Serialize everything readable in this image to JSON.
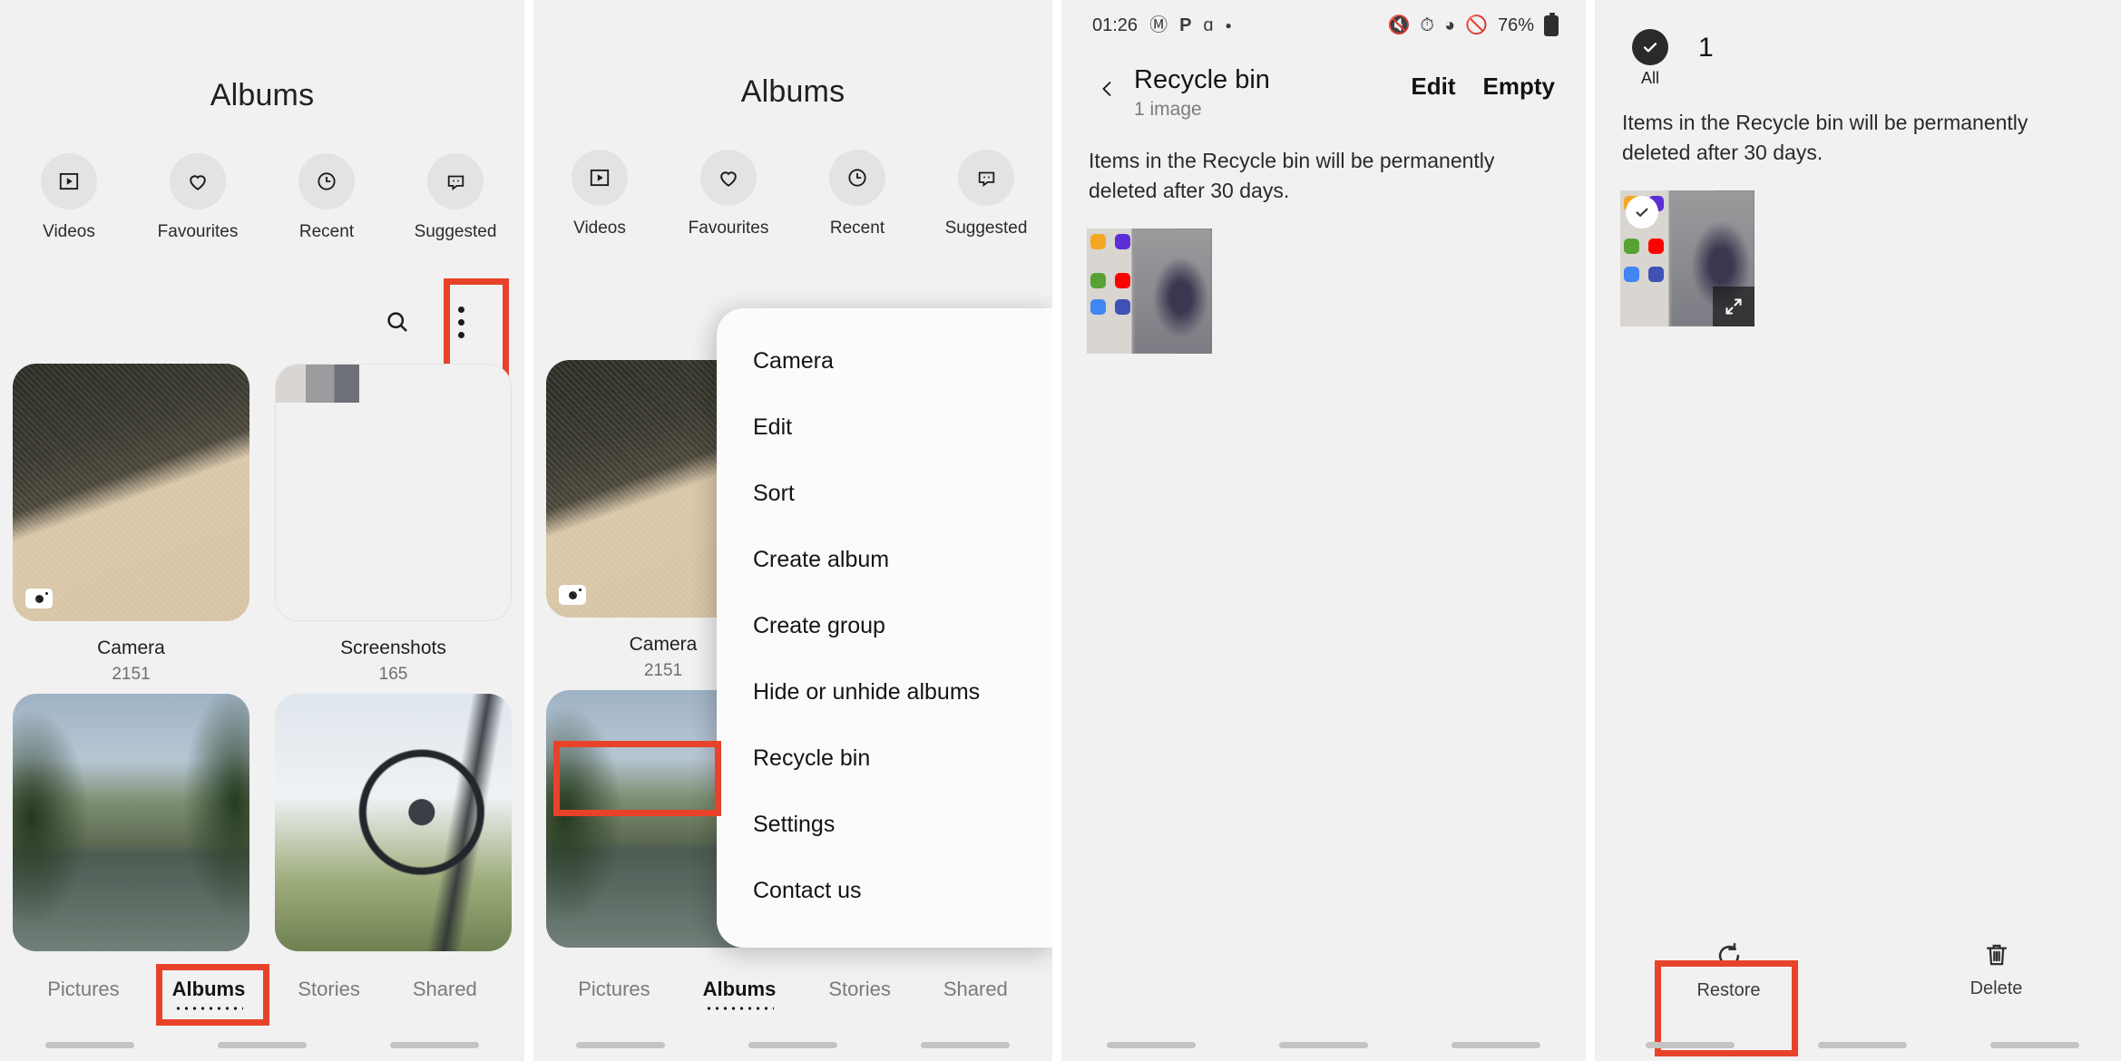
{
  "panel1": {
    "title": "Albums",
    "quick_items": [
      {
        "label": "Videos",
        "icon": "video-icon"
      },
      {
        "label": "Favourites",
        "icon": "heart-icon"
      },
      {
        "label": "Recent",
        "icon": "clock-icon"
      },
      {
        "label": "Suggested",
        "icon": "suggested-icon"
      }
    ],
    "search_icon": "search-icon",
    "more_icon": "more-vertical-icon",
    "albums": [
      {
        "name": "Camera",
        "count": "2151"
      },
      {
        "name": "Screenshots",
        "count": "165"
      }
    ],
    "tabs": [
      {
        "label": "Pictures",
        "active": false
      },
      {
        "label": "Albums",
        "active": true
      },
      {
        "label": "Stories",
        "active": false
      },
      {
        "label": "Shared",
        "active": false
      }
    ]
  },
  "panel2": {
    "title": "Albums",
    "quick_items": [
      {
        "label": "Videos",
        "icon": "video-icon"
      },
      {
        "label": "Favourites",
        "icon": "heart-icon"
      },
      {
        "label": "Recent",
        "icon": "clock-icon"
      },
      {
        "label": "Suggested",
        "icon": "suggested-icon"
      }
    ],
    "albums": [
      {
        "name": "Camera",
        "count": "2151"
      }
    ],
    "menu_items": [
      "Camera",
      "Edit",
      "Sort",
      "Create album",
      "Create group",
      "Hide or unhide albums",
      "Recycle bin",
      "Settings",
      "Contact us"
    ],
    "highlighted_menu_item": "Recycle bin",
    "tabs": [
      {
        "label": "Pictures",
        "active": false
      },
      {
        "label": "Albums",
        "active": true
      },
      {
        "label": "Stories",
        "active": false
      },
      {
        "label": "Shared",
        "active": false
      }
    ]
  },
  "panel3": {
    "status": {
      "time": "01:26",
      "left_icons": [
        "gmail-icon",
        "paypal-icon",
        "wattpad-icon",
        "dot-icon"
      ],
      "right_icons": [
        "mute-vibrate-icon",
        "alarm-icon",
        "wifi-icon",
        "do-not-disturb-icon"
      ],
      "battery": "76%"
    },
    "back_icon": "back-chevron-icon",
    "title": "Recycle bin",
    "subtitle": "1 image",
    "actions": [
      "Edit",
      "Empty"
    ],
    "note": "Items in the Recycle bin will be permanently deleted after 30 days.",
    "thumb_icons": [
      {
        "name": "My Files",
        "color": "#f5a623"
      },
      {
        "name": "Clock",
        "color": "#5b2ed6"
      },
      {
        "name": "Calculator",
        "color": "#57a233"
      },
      {
        "name": "YouTube",
        "color": "#ff0000"
      },
      {
        "name": "Chrome",
        "color": "#4285f4"
      },
      {
        "name": "Messages",
        "color": "#3f51b5"
      }
    ]
  },
  "panel4": {
    "select_all_label": "All",
    "select_all_icon": "check-circle-icon",
    "selected_count": "1",
    "note": "Items in the Recycle bin will be permanently deleted after 30 days.",
    "thumb_check_icon": "check-icon",
    "expand_icon": "expand-icon",
    "actions": [
      {
        "label": "Restore",
        "icon": "restore-icon",
        "highlighted": true
      },
      {
        "label": "Delete",
        "icon": "trash-icon",
        "highlighted": false
      }
    ],
    "thumb_icons": [
      {
        "name": "My Files",
        "color": "#f5a623"
      },
      {
        "name": "Clock",
        "color": "#5b2ed6"
      },
      {
        "name": "Calculator",
        "color": "#57a233"
      },
      {
        "name": "YouTube",
        "color": "#ff0000"
      },
      {
        "name": "Chrome",
        "color": "#4285f4"
      },
      {
        "name": "Messages",
        "color": "#3f51b5"
      }
    ]
  },
  "colors": {
    "highlight": "#e8432a",
    "background": "#f1f1f1",
    "menu_background": "#fbfbfb"
  }
}
